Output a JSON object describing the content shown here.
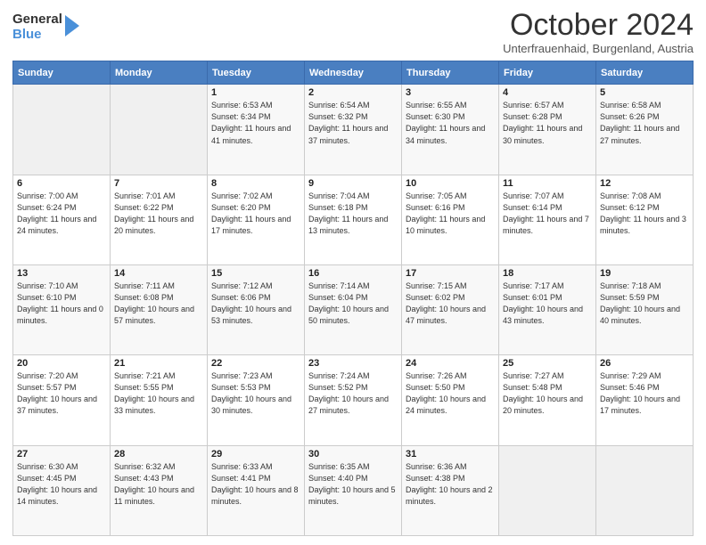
{
  "header": {
    "logo": {
      "general": "General",
      "blue": "Blue"
    },
    "title": "October 2024",
    "subtitle": "Unterfrauenhaid, Burgenland, Austria"
  },
  "weekdays": [
    "Sunday",
    "Monday",
    "Tuesday",
    "Wednesday",
    "Thursday",
    "Friday",
    "Saturday"
  ],
  "weeks": [
    [
      {
        "day": "",
        "sunrise": "",
        "sunset": "",
        "daylight": ""
      },
      {
        "day": "",
        "sunrise": "",
        "sunset": "",
        "daylight": ""
      },
      {
        "day": "1",
        "sunrise": "Sunrise: 6:53 AM",
        "sunset": "Sunset: 6:34 PM",
        "daylight": "Daylight: 11 hours and 41 minutes."
      },
      {
        "day": "2",
        "sunrise": "Sunrise: 6:54 AM",
        "sunset": "Sunset: 6:32 PM",
        "daylight": "Daylight: 11 hours and 37 minutes."
      },
      {
        "day": "3",
        "sunrise": "Sunrise: 6:55 AM",
        "sunset": "Sunset: 6:30 PM",
        "daylight": "Daylight: 11 hours and 34 minutes."
      },
      {
        "day": "4",
        "sunrise": "Sunrise: 6:57 AM",
        "sunset": "Sunset: 6:28 PM",
        "daylight": "Daylight: 11 hours and 30 minutes."
      },
      {
        "day": "5",
        "sunrise": "Sunrise: 6:58 AM",
        "sunset": "Sunset: 6:26 PM",
        "daylight": "Daylight: 11 hours and 27 minutes."
      }
    ],
    [
      {
        "day": "6",
        "sunrise": "Sunrise: 7:00 AM",
        "sunset": "Sunset: 6:24 PM",
        "daylight": "Daylight: 11 hours and 24 minutes."
      },
      {
        "day": "7",
        "sunrise": "Sunrise: 7:01 AM",
        "sunset": "Sunset: 6:22 PM",
        "daylight": "Daylight: 11 hours and 20 minutes."
      },
      {
        "day": "8",
        "sunrise": "Sunrise: 7:02 AM",
        "sunset": "Sunset: 6:20 PM",
        "daylight": "Daylight: 11 hours and 17 minutes."
      },
      {
        "day": "9",
        "sunrise": "Sunrise: 7:04 AM",
        "sunset": "Sunset: 6:18 PM",
        "daylight": "Daylight: 11 hours and 13 minutes."
      },
      {
        "day": "10",
        "sunrise": "Sunrise: 7:05 AM",
        "sunset": "Sunset: 6:16 PM",
        "daylight": "Daylight: 11 hours and 10 minutes."
      },
      {
        "day": "11",
        "sunrise": "Sunrise: 7:07 AM",
        "sunset": "Sunset: 6:14 PM",
        "daylight": "Daylight: 11 hours and 7 minutes."
      },
      {
        "day": "12",
        "sunrise": "Sunrise: 7:08 AM",
        "sunset": "Sunset: 6:12 PM",
        "daylight": "Daylight: 11 hours and 3 minutes."
      }
    ],
    [
      {
        "day": "13",
        "sunrise": "Sunrise: 7:10 AM",
        "sunset": "Sunset: 6:10 PM",
        "daylight": "Daylight: 11 hours and 0 minutes."
      },
      {
        "day": "14",
        "sunrise": "Sunrise: 7:11 AM",
        "sunset": "Sunset: 6:08 PM",
        "daylight": "Daylight: 10 hours and 57 minutes."
      },
      {
        "day": "15",
        "sunrise": "Sunrise: 7:12 AM",
        "sunset": "Sunset: 6:06 PM",
        "daylight": "Daylight: 10 hours and 53 minutes."
      },
      {
        "day": "16",
        "sunrise": "Sunrise: 7:14 AM",
        "sunset": "Sunset: 6:04 PM",
        "daylight": "Daylight: 10 hours and 50 minutes."
      },
      {
        "day": "17",
        "sunrise": "Sunrise: 7:15 AM",
        "sunset": "Sunset: 6:02 PM",
        "daylight": "Daylight: 10 hours and 47 minutes."
      },
      {
        "day": "18",
        "sunrise": "Sunrise: 7:17 AM",
        "sunset": "Sunset: 6:01 PM",
        "daylight": "Daylight: 10 hours and 43 minutes."
      },
      {
        "day": "19",
        "sunrise": "Sunrise: 7:18 AM",
        "sunset": "Sunset: 5:59 PM",
        "daylight": "Daylight: 10 hours and 40 minutes."
      }
    ],
    [
      {
        "day": "20",
        "sunrise": "Sunrise: 7:20 AM",
        "sunset": "Sunset: 5:57 PM",
        "daylight": "Daylight: 10 hours and 37 minutes."
      },
      {
        "day": "21",
        "sunrise": "Sunrise: 7:21 AM",
        "sunset": "Sunset: 5:55 PM",
        "daylight": "Daylight: 10 hours and 33 minutes."
      },
      {
        "day": "22",
        "sunrise": "Sunrise: 7:23 AM",
        "sunset": "Sunset: 5:53 PM",
        "daylight": "Daylight: 10 hours and 30 minutes."
      },
      {
        "day": "23",
        "sunrise": "Sunrise: 7:24 AM",
        "sunset": "Sunset: 5:52 PM",
        "daylight": "Daylight: 10 hours and 27 minutes."
      },
      {
        "day": "24",
        "sunrise": "Sunrise: 7:26 AM",
        "sunset": "Sunset: 5:50 PM",
        "daylight": "Daylight: 10 hours and 24 minutes."
      },
      {
        "day": "25",
        "sunrise": "Sunrise: 7:27 AM",
        "sunset": "Sunset: 5:48 PM",
        "daylight": "Daylight: 10 hours and 20 minutes."
      },
      {
        "day": "26",
        "sunrise": "Sunrise: 7:29 AM",
        "sunset": "Sunset: 5:46 PM",
        "daylight": "Daylight: 10 hours and 17 minutes."
      }
    ],
    [
      {
        "day": "27",
        "sunrise": "Sunrise: 6:30 AM",
        "sunset": "Sunset: 4:45 PM",
        "daylight": "Daylight: 10 hours and 14 minutes."
      },
      {
        "day": "28",
        "sunrise": "Sunrise: 6:32 AM",
        "sunset": "Sunset: 4:43 PM",
        "daylight": "Daylight: 10 hours and 11 minutes."
      },
      {
        "day": "29",
        "sunrise": "Sunrise: 6:33 AM",
        "sunset": "Sunset: 4:41 PM",
        "daylight": "Daylight: 10 hours and 8 minutes."
      },
      {
        "day": "30",
        "sunrise": "Sunrise: 6:35 AM",
        "sunset": "Sunset: 4:40 PM",
        "daylight": "Daylight: 10 hours and 5 minutes."
      },
      {
        "day": "31",
        "sunrise": "Sunrise: 6:36 AM",
        "sunset": "Sunset: 4:38 PM",
        "daylight": "Daylight: 10 hours and 2 minutes."
      },
      {
        "day": "",
        "sunrise": "",
        "sunset": "",
        "daylight": ""
      },
      {
        "day": "",
        "sunrise": "",
        "sunset": "",
        "daylight": ""
      }
    ]
  ]
}
